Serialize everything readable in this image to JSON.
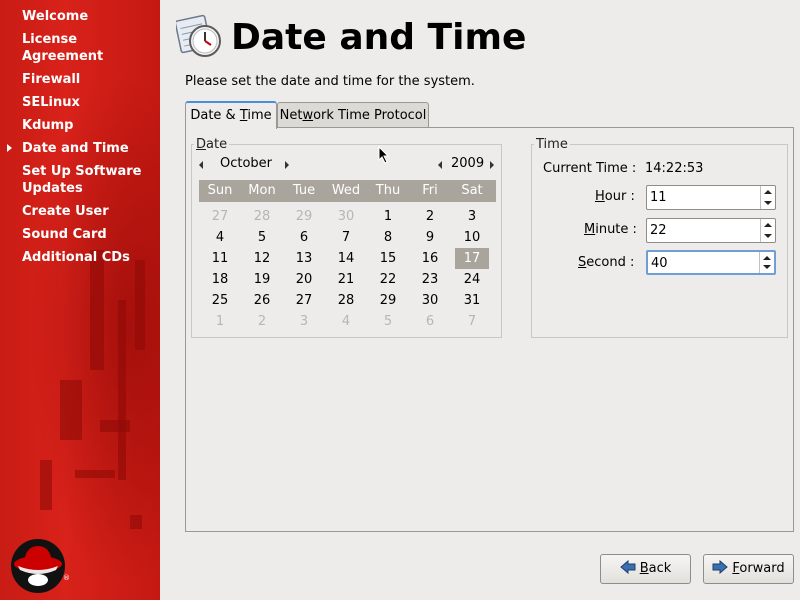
{
  "sidebar": {
    "items": [
      {
        "label": "Welcome",
        "current": false
      },
      {
        "label": "License Agreement",
        "current": false
      },
      {
        "label": "Firewall",
        "current": false
      },
      {
        "label": "SELinux",
        "current": false
      },
      {
        "label": "Kdump",
        "current": false
      },
      {
        "label": "Date and Time",
        "current": true
      },
      {
        "label": "Set Up Software Updates",
        "current": false
      },
      {
        "label": "Create User",
        "current": false
      },
      {
        "label": "Sound Card",
        "current": false
      },
      {
        "label": "Additional CDs",
        "current": false
      }
    ],
    "logo_mark": "®"
  },
  "header": {
    "title": "Date and Time",
    "icon": "calendar-clock-icon",
    "instruction": "Please set the date and time for the system."
  },
  "tabs": [
    {
      "label": "Date & Time",
      "mnemonic": "T",
      "active": true
    },
    {
      "label": "Network Time Protocol",
      "mnemonic": "w",
      "active": false
    }
  ],
  "date_frame": {
    "legend": "Date",
    "legend_mnemonic": "D",
    "month": "October",
    "year": "2009",
    "weekdays": [
      "Sun",
      "Mon",
      "Tue",
      "Wed",
      "Thu",
      "Fri",
      "Sat"
    ],
    "weeks": [
      [
        "27",
        "28",
        "29",
        "30",
        "1",
        "2",
        "3"
      ],
      [
        "4",
        "5",
        "6",
        "7",
        "8",
        "9",
        "10"
      ],
      [
        "11",
        "12",
        "13",
        "14",
        "15",
        "16",
        "17"
      ],
      [
        "18",
        "19",
        "20",
        "21",
        "22",
        "23",
        "24"
      ],
      [
        "25",
        "26",
        "27",
        "28",
        "29",
        "30",
        "31"
      ],
      [
        "1",
        "2",
        "3",
        "4",
        "5",
        "6",
        "7"
      ]
    ],
    "selected_day": "17"
  },
  "time_frame": {
    "legend": "Time",
    "current_time_label": "Current Time :",
    "current_time_value": "14:22:53",
    "hour_label": "Hour :",
    "hour_value": "11",
    "minute_label": "Minute :",
    "minute_value": "22",
    "second_label": "Second :",
    "second_value": "40"
  },
  "buttons": {
    "back_label": "Back",
    "forward_label": "Forward"
  },
  "colors": {
    "sidebar_red": "#cc0000",
    "selected_day_bg": "#a9a59d",
    "tab_highlight": "#4a90d9"
  }
}
